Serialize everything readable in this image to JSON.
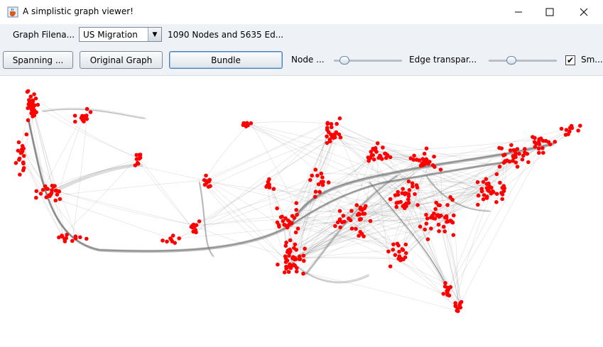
{
  "window": {
    "title": "A simplistic graph viewer!"
  },
  "toolbar": {
    "filename_label": "Graph Filena...",
    "filename_selected": "US Migration",
    "graph_info": "1090 Nodes and 5635 Ed...",
    "spanning_label": "Spanning ...",
    "original_label": "Original Graph",
    "bundle_label": "Bundle",
    "node_label": "Node ...",
    "edge_label": "Edge transpar...",
    "smooth_label": "Sm...",
    "smooth_checked": true,
    "node_slider_value": 0.1,
    "edge_slider_value": 0.3
  },
  "colors": {
    "node": "#ff0000",
    "edge": "#777777",
    "toolbar_bg": "#eef1f5"
  },
  "icons": {
    "app": "java-cup-icon",
    "minimize": "minimize-icon",
    "maximize": "maximize-icon",
    "close": "close-icon",
    "dropdown": "chevron-down-icon"
  }
}
